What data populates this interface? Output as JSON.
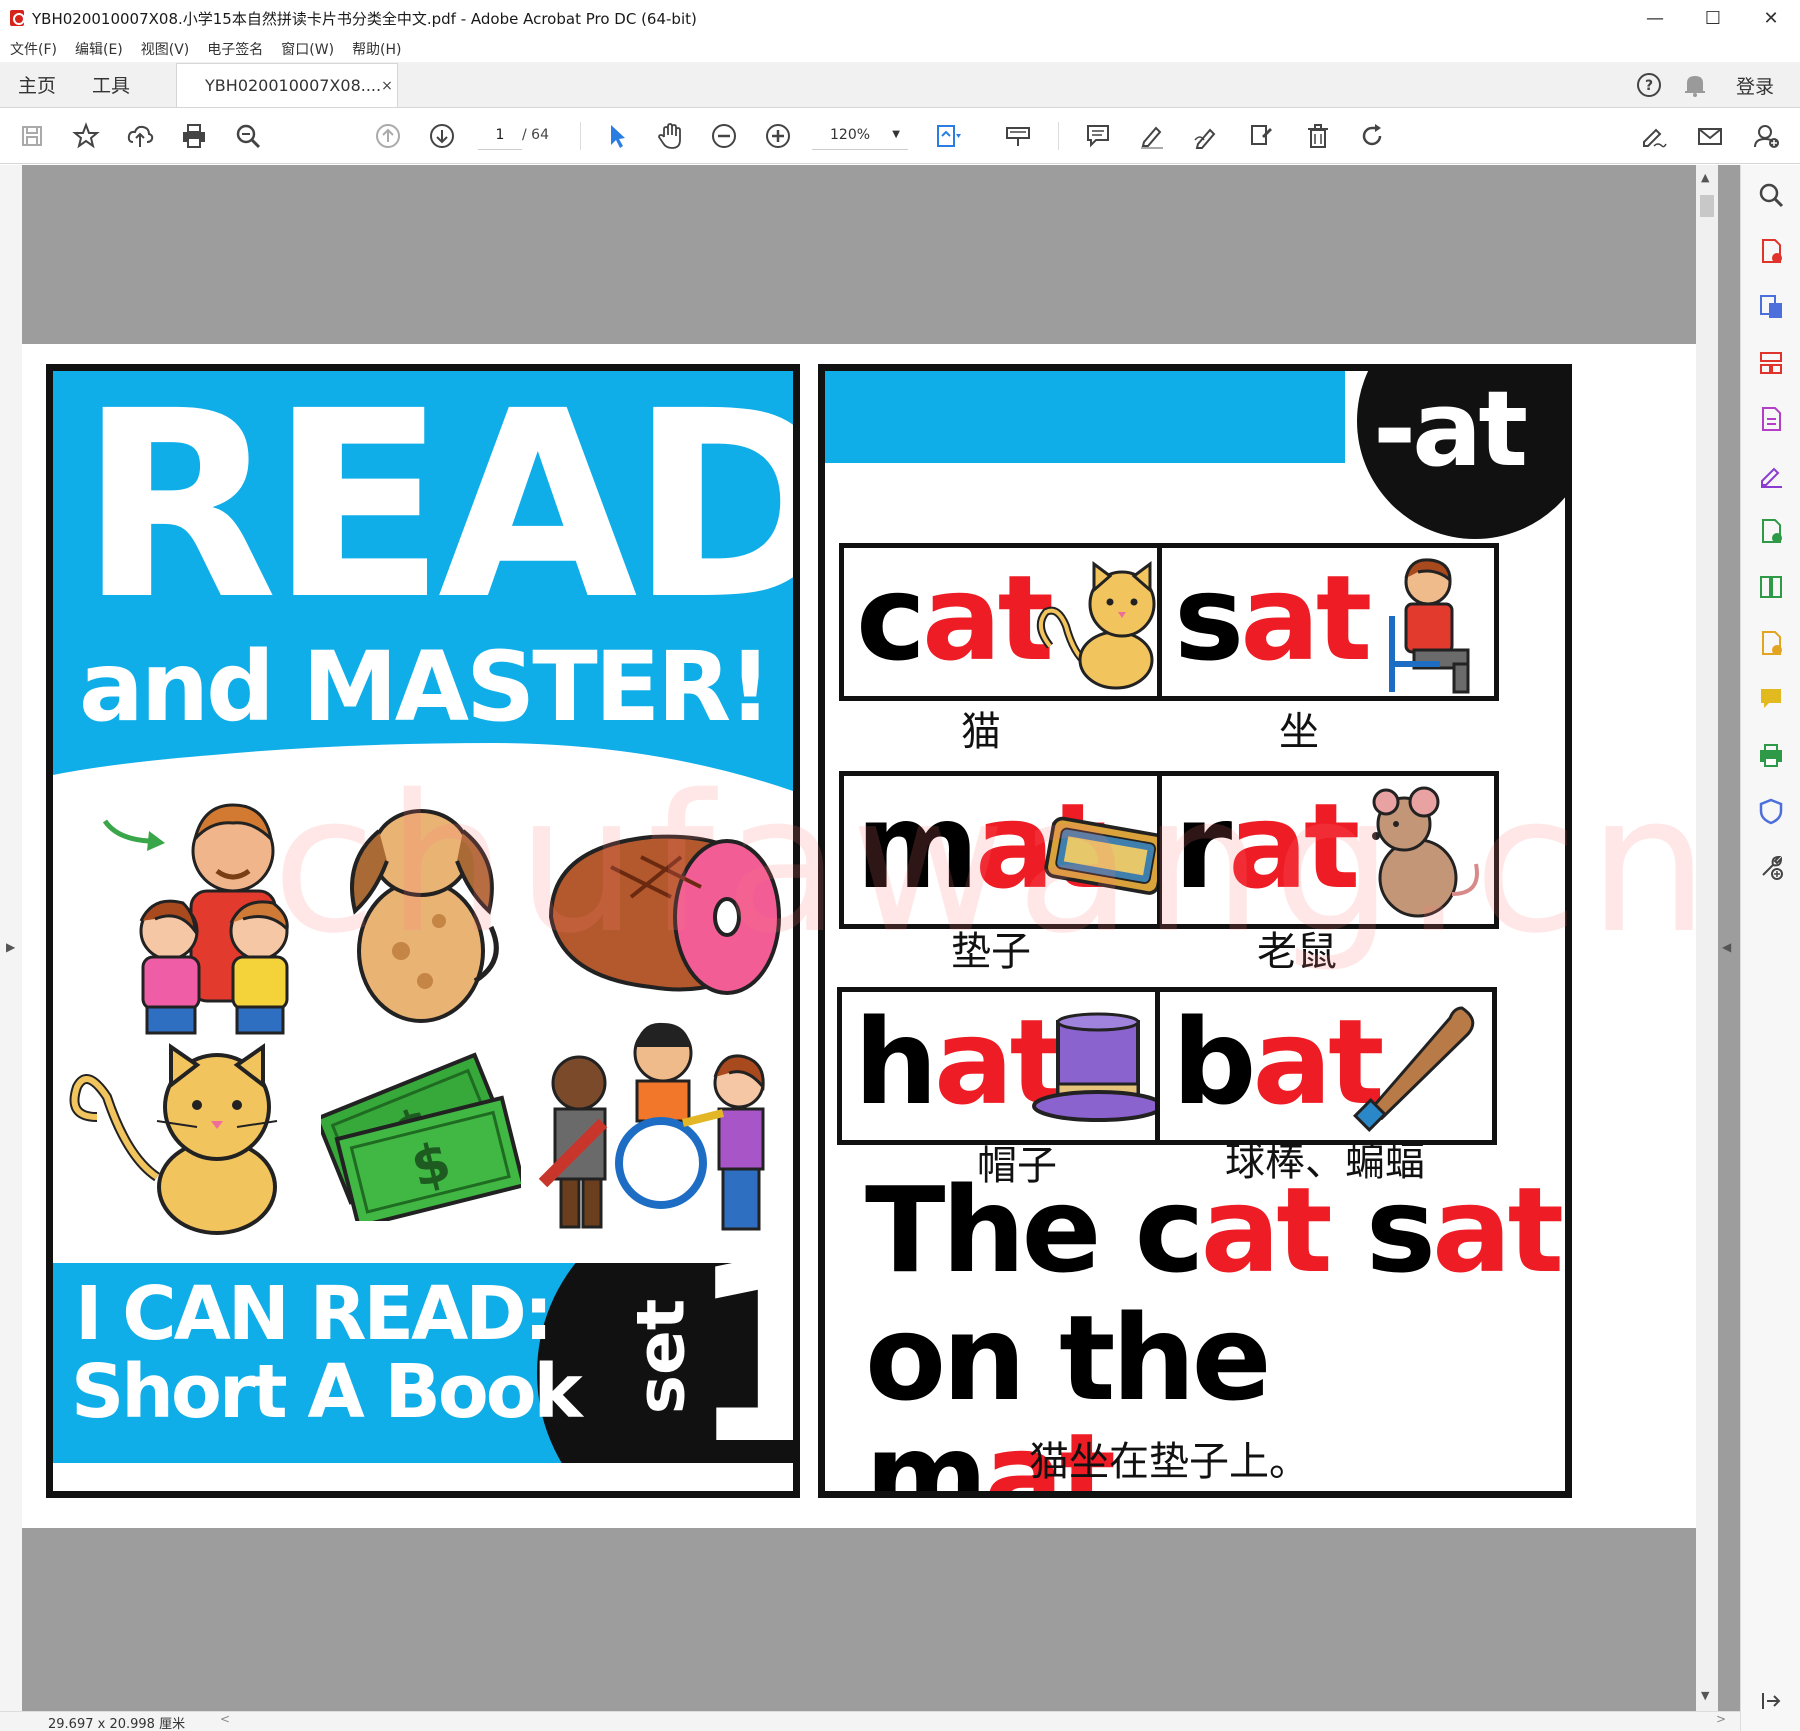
{
  "window": {
    "title": "YBH020010007X08.小学15本自然拼读卡片书分类全中文.pdf - Adobe Acrobat Pro DC (64-bit)",
    "minimize": "—",
    "maximize": "☐",
    "close": "✕"
  },
  "menu": [
    "文件(F)",
    "编辑(E)",
    "视图(V)",
    "电子签名",
    "窗口(W)",
    "帮助(H)"
  ],
  "tabs": {
    "home": "主页",
    "tools": "工具",
    "document": "YBH020010007X08....",
    "close": "×",
    "login": "登录"
  },
  "toolbar": {
    "page_current": "1",
    "page_total": "/ 64",
    "zoom": "120%"
  },
  "status": {
    "dimensions": "29.697 x 20.998 厘米"
  },
  "cover": {
    "title_line1": "READ",
    "title_line2": "and MASTER!",
    "subtitle_line1": "I CAN READ:",
    "subtitle_line2": "Short A Book",
    "set_word": "set",
    "set_number": "1"
  },
  "word_card": {
    "family": "-at",
    "words": [
      {
        "onset": "c",
        "rime": "at",
        "cn": "猫",
        "picture": "cat-picture"
      },
      {
        "onset": "s",
        "rime": "at",
        "cn": "坐",
        "picture": "sitting-boy-picture"
      },
      {
        "onset": "m",
        "rime": "at",
        "cn": "垫子",
        "picture": "welcome-mat-picture"
      },
      {
        "onset": "r",
        "rime": "at",
        "cn": "老鼠",
        "picture": "rat-picture"
      },
      {
        "onset": "h",
        "rime": "at",
        "cn": "帽子",
        "picture": "hat-picture"
      },
      {
        "onset": "b",
        "rime": "at",
        "cn": "球棒、蝙蝠",
        "picture": "bat-picture"
      }
    ],
    "sentence": {
      "w1": "The",
      "w2_onset": "c",
      "w2_rime": "at",
      "w3_onset": "s",
      "w3_rime": "at",
      "w4": "on",
      "w5": "the",
      "w6_onset": "m",
      "w6_rime": "at",
      "w6_punct": "."
    },
    "sentence_cn": "猫坐在垫子上。"
  },
  "watermark": "chufawang.cn",
  "colors": {
    "cover_blue": "#10aee8",
    "rime_red": "#ee1c25",
    "acrobat_blue": "#2a7de1",
    "page_gray": "#9d9d9d"
  }
}
